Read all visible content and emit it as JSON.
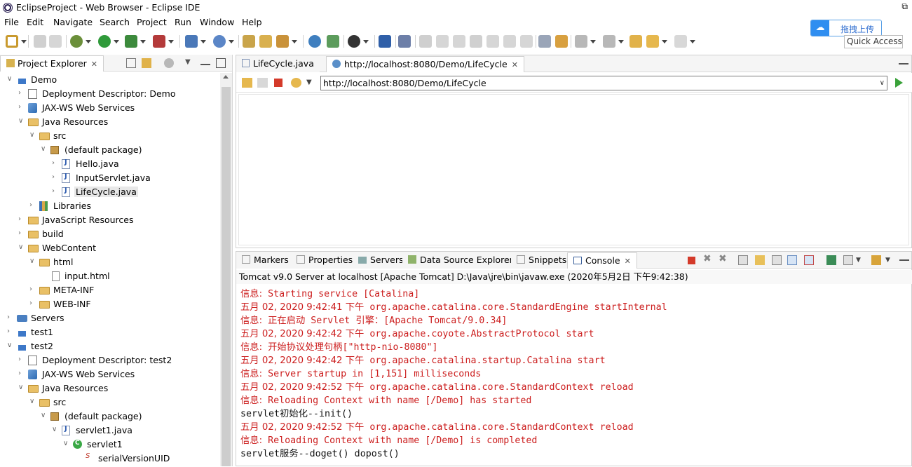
{
  "window": {
    "title": "EclipseProject - Web Browser - Eclipse IDE",
    "restore_glyph": "⧉"
  },
  "menu": [
    "File",
    "Edit",
    "Navigate",
    "Search",
    "Project",
    "Run",
    "Window",
    "Help"
  ],
  "upload": {
    "label": "拖拽上传"
  },
  "quick_access": {
    "placeholder": "Quick Access"
  },
  "explorer": {
    "tab_label": "Project Explorer",
    "items": [
      {
        "label": "Demo",
        "icon": "project-icon",
        "expanded": true
      },
      {
        "label": "Deployment Descriptor: Demo",
        "icon": "deployment-descriptor-icon"
      },
      {
        "label": "JAX-WS Web Services",
        "icon": "web-services-icon"
      },
      {
        "label": "Java Resources",
        "icon": "java-resources-icon",
        "expanded": true
      },
      {
        "label": "src",
        "icon": "source-folder-icon",
        "expanded": true
      },
      {
        "label": "(default package)",
        "icon": "package-icon",
        "expanded": true
      },
      {
        "label": "Hello.java",
        "icon": "java-file-icon"
      },
      {
        "label": "InputServlet.java",
        "icon": "java-file-icon"
      },
      {
        "label": "LifeCycle.java",
        "icon": "java-file-icon",
        "selected": true
      },
      {
        "label": "Libraries",
        "icon": "libraries-icon"
      },
      {
        "label": "JavaScript Resources",
        "icon": "javascript-resources-icon"
      },
      {
        "label": "build",
        "icon": "folder-icon"
      },
      {
        "label": "WebContent",
        "icon": "folder-icon",
        "expanded": true
      },
      {
        "label": "html",
        "icon": "folder-icon",
        "expanded": true
      },
      {
        "label": "input.html",
        "icon": "html-file-icon"
      },
      {
        "label": "META-INF",
        "icon": "folder-icon"
      },
      {
        "label": "WEB-INF",
        "icon": "folder-icon"
      },
      {
        "label": "Servers",
        "icon": "servers-icon"
      },
      {
        "label": "test1",
        "icon": "project-icon"
      },
      {
        "label": "test2",
        "icon": "project-icon",
        "expanded": true
      },
      {
        "label": "Deployment Descriptor: test2",
        "icon": "deployment-descriptor-icon"
      },
      {
        "label": "JAX-WS Web Services",
        "icon": "web-services-icon"
      },
      {
        "label": "Java Resources",
        "icon": "java-resources-icon",
        "expanded": true
      },
      {
        "label": "src",
        "icon": "source-folder-icon",
        "expanded": true
      },
      {
        "label": "(default package)",
        "icon": "package-icon",
        "expanded": true
      },
      {
        "label": "servlet1.java",
        "icon": "java-file-icon",
        "expanded": true
      },
      {
        "label": "servlet1",
        "icon": "class-icon",
        "expanded": true
      },
      {
        "label": "serialVersionUID",
        "icon": "static-field-icon"
      }
    ]
  },
  "editor": {
    "tabs": [
      {
        "label": "LifeCycle.java",
        "icon": "java-file-icon",
        "active": false
      },
      {
        "label": "http://localhost:8080/Demo/LifeCycle",
        "icon": "globe-icon",
        "active": true
      }
    ],
    "url": "http://localhost:8080/Demo/LifeCycle"
  },
  "bottom": {
    "tabs": [
      "Markers",
      "Properties",
      "Servers",
      "Data Source Explorer",
      "Snippets",
      "Console"
    ],
    "active_tab": "Console",
    "console_header": "Tomcat v9.0 Server at localhost [Apache Tomcat] D:\\Java\\jre\\bin\\javaw.exe (2020年5月2日 下午9:42:38)",
    "lines": [
      {
        "prefix": "信息:",
        "text": " Starting service [Catalina]",
        "color": "red"
      },
      {
        "prefix": "五月 02, 2020 9:42:41 下午",
        "text": " org.apache.catalina.core.StandardEngine startInternal",
        "color": "red"
      },
      {
        "prefix": "信息:",
        "text": " 正在启动 Servlet 引擎：[Apache Tomcat/9.0.34]",
        "color": "red"
      },
      {
        "prefix": "五月 02, 2020 9:42:42 下午",
        "text": " org.apache.coyote.AbstractProtocol start",
        "color": "red"
      },
      {
        "prefix": "信息:",
        "text": " 开始协议处理句柄[\"http-nio-8080\"]",
        "color": "red"
      },
      {
        "prefix": "五月 02, 2020 9:42:42 下午",
        "text": " org.apache.catalina.startup.Catalina start",
        "color": "red"
      },
      {
        "prefix": "信息:",
        "text": " Server startup in [1,151] milliseconds",
        "color": "red"
      },
      {
        "prefix": "五月 02, 2020 9:42:52 下午",
        "text": " org.apache.catalina.core.StandardContext reload",
        "color": "red"
      },
      {
        "prefix": "信息:",
        "text": " Reloading Context with name [/Demo] has started",
        "color": "red"
      },
      {
        "prefix": "",
        "text": "servlet初始化--init()",
        "color": "black"
      },
      {
        "prefix": "五月 02, 2020 9:42:52 下午",
        "text": " org.apache.catalina.core.StandardContext reload",
        "color": "red"
      },
      {
        "prefix": "信息:",
        "text": " Reloading Context with name [/Demo] is completed",
        "color": "red"
      },
      {
        "prefix": "",
        "text": "servlet服务--doget() dopost()",
        "color": "black"
      }
    ]
  }
}
